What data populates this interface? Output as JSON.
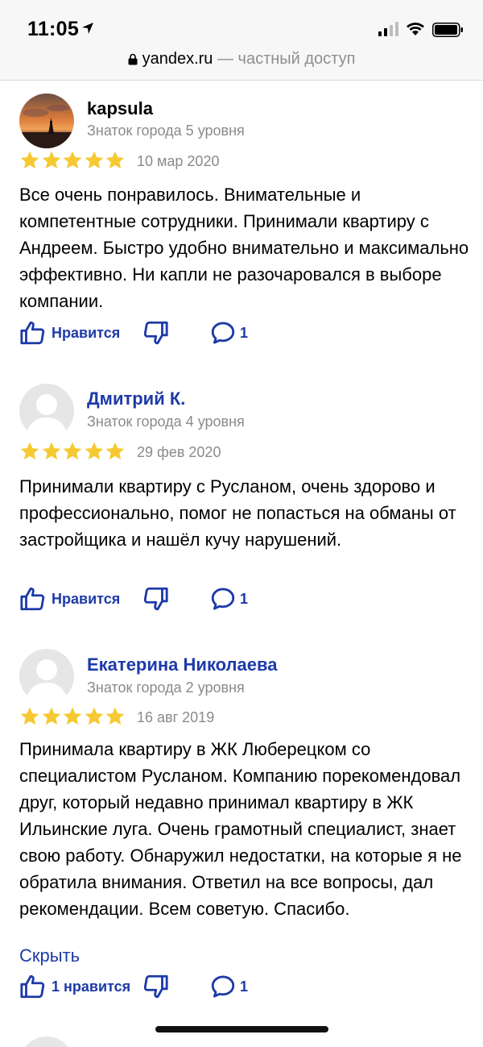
{
  "status_bar": {
    "time": "11:05"
  },
  "browser": {
    "domain": "yandex.ru",
    "suffix": " — частный доступ"
  },
  "reviews": [
    {
      "name": "kapsula",
      "level": "Знаток города 5 уровня",
      "rating": 5,
      "date": "10 мар 2020",
      "text": "Все очень понравилось. Внимательные и компетентные сотрудники. Принимали квартиру с Андреем. Быстро удобно внимательно и максимально эффективно. Ни капли не разочаровался в выборе компании.",
      "like_label": "Нравится",
      "comments": "1"
    },
    {
      "name": "Дмитрий К.",
      "level": "Знаток города 4 уровня",
      "rating": 5,
      "date": "29 фев 2020",
      "text": "Принимали квартиру с Русланом, очень здорово и профессионально, помог не попасться на обманы от застройщика и нашёл кучу нарушений.",
      "like_label": "Нравится",
      "comments": "1"
    },
    {
      "name": "Екатерина Николаева",
      "level": "Знаток города 2 уровня",
      "rating": 5,
      "date": "16 авг 2019",
      "text": "Принимала квартиру в ЖК Люберецком со специалистом Русланом. Компанию порекомендовал друг, который недавно принимал квартиру в ЖК Ильинские луга. Очень грамотный специалист, знает свою работу. Обнаружил недостатки, на которые я не обратила внимания. Ответил на все вопросы, дал рекомендации. Всем советую. Спасибо.",
      "hide_label": "Скрыть",
      "like_label": "1 нравится",
      "comments": "1"
    }
  ],
  "colors": {
    "star": "#f6c932",
    "link": "#1d3aa8",
    "muted": "#8a8a8a"
  },
  "icons": [
    "location-arrow-icon",
    "signal-icon",
    "wifi-icon",
    "battery-icon",
    "lock-icon",
    "star-icon",
    "thumbs-up-icon",
    "thumbs-down-icon",
    "comment-icon",
    "default-avatar-icon"
  ]
}
